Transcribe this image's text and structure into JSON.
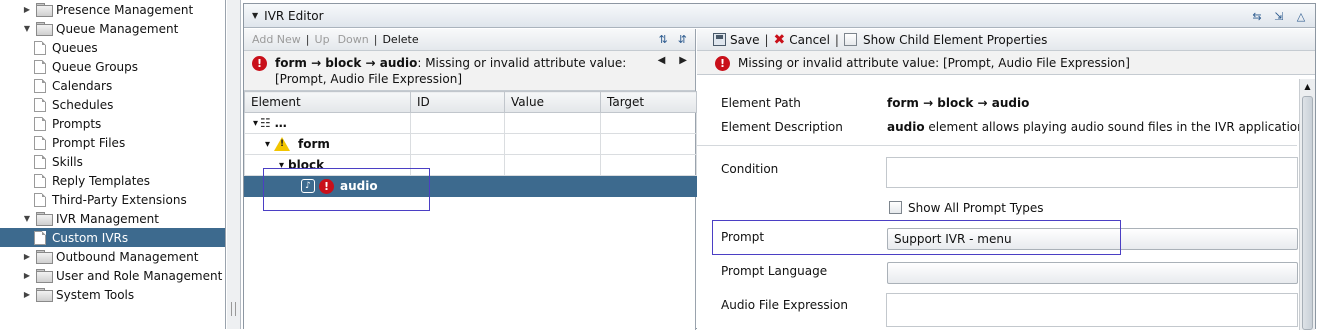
{
  "nav": {
    "items": [
      {
        "label": "Presence Management",
        "toggle": "▶",
        "type": "folder",
        "indent": 0
      },
      {
        "label": "Queue Management",
        "toggle": "▼",
        "type": "folder",
        "indent": 0
      },
      {
        "label": "Queues",
        "toggle": "",
        "type": "page",
        "indent": 1
      },
      {
        "label": "Queue Groups",
        "toggle": "",
        "type": "page",
        "indent": 1
      },
      {
        "label": "Calendars",
        "toggle": "",
        "type": "page",
        "indent": 1
      },
      {
        "label": "Schedules",
        "toggle": "",
        "type": "page",
        "indent": 1
      },
      {
        "label": "Prompts",
        "toggle": "",
        "type": "page",
        "indent": 1
      },
      {
        "label": "Prompt Files",
        "toggle": "",
        "type": "page",
        "indent": 1
      },
      {
        "label": "Skills",
        "toggle": "",
        "type": "page",
        "indent": 1
      },
      {
        "label": "Reply Templates",
        "toggle": "",
        "type": "page",
        "indent": 1
      },
      {
        "label": "Third-Party Extensions",
        "toggle": "",
        "type": "page",
        "indent": 1
      },
      {
        "label": "IVR Management",
        "toggle": "▼",
        "type": "folder",
        "indent": 0
      },
      {
        "label": "Custom IVRs",
        "toggle": "",
        "type": "page",
        "indent": 1,
        "selected": true
      },
      {
        "label": "Outbound Management",
        "toggle": "▶",
        "type": "folder",
        "indent": 0
      },
      {
        "label": "User and Role Management",
        "toggle": "▶",
        "type": "folder",
        "indent": 0
      },
      {
        "label": "System Tools",
        "toggle": "▶",
        "type": "folder",
        "indent": 0
      }
    ]
  },
  "editor": {
    "title": "IVR Editor",
    "tree_toolbar": {
      "add_new": "Add New",
      "sep": "|",
      "up": "Up",
      "down": "Down",
      "delete": "Delete"
    },
    "tree_error": {
      "path": "form → block → audio",
      "message": ": Missing or invalid attribute value: [Prompt, Audio File Expression]"
    },
    "columns": [
      "Element",
      "ID",
      "Value",
      "Target"
    ],
    "rows": [
      {
        "label": "…",
        "toggle": "▾",
        "icon": "org"
      },
      {
        "label": "form",
        "toggle": "▾",
        "icon": "warning"
      },
      {
        "label": "block",
        "toggle": "▾",
        "icon": ""
      },
      {
        "label": "audio",
        "toggle": "",
        "icon": "audio-error",
        "selected": true
      }
    ],
    "props_toolbar": {
      "save": "Save",
      "cancel": "Cancel",
      "sep": "|",
      "show_child": "Show Child Element Properties"
    },
    "props_error": "Missing or invalid attribute value: [Prompt, Audio File Expression]",
    "properties": {
      "element_path_label": "Element Path",
      "element_path_value": "form → block → audio",
      "element_desc_label": "Element Description",
      "element_desc_bold": "audio",
      "element_desc_rest": " element allows playing audio sound files in the IVR application.",
      "condition_label": "Condition",
      "condition_value": "",
      "show_all_prompts": "Show All Prompt Types",
      "prompt_label": "Prompt",
      "prompt_value": "Support IVR - menu",
      "prompt_language_label": "Prompt Language",
      "prompt_language_value": "",
      "audio_file_label": "Audio File Expression",
      "audio_file_value": ""
    }
  }
}
